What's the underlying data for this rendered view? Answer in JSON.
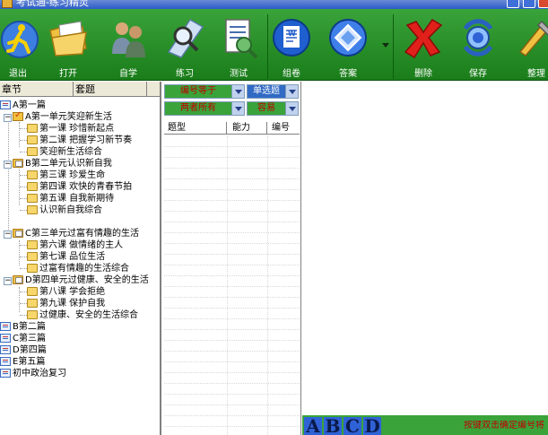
{
  "window": {
    "title": "考试通-练习精灵"
  },
  "toolbar": {
    "buttons": [
      {
        "id": "exit",
        "label": "退出",
        "icon": "running-man-icon"
      },
      {
        "id": "open",
        "label": "打开",
        "icon": "open-folder-icon"
      },
      {
        "id": "self_study",
        "label": "自学",
        "icon": "people-icon"
      },
      {
        "id": "practice",
        "label": "练习",
        "icon": "practice-magnifier-icon"
      },
      {
        "id": "test",
        "label": "测试",
        "icon": "test-document-icon"
      },
      {
        "id": "assemble",
        "label": "组卷",
        "icon": "word-document-icon"
      },
      {
        "id": "answers",
        "label": "答案",
        "icon": "answer-diamond-icon"
      },
      {
        "id": "delete",
        "label": "删除",
        "icon": "red-x-icon"
      },
      {
        "id": "save",
        "label": "保存",
        "icon": "save-globe-icon"
      },
      {
        "id": "organize",
        "label": "整理",
        "icon": "organize-tools-icon"
      }
    ]
  },
  "left_panel": {
    "tabs": [
      "章节",
      "套题"
    ],
    "tree": [
      {
        "label": "A第一篇",
        "icon": "book-icon"
      },
      {
        "label": "A第一单元笑迎新生活",
        "icon": "folder-check-icon"
      },
      {
        "label": "第一课  珍惜新起点",
        "icon": "folder-icon"
      },
      {
        "label": "第二课  把握学习新节奏",
        "icon": "folder-icon"
      },
      {
        "label": "笑迎新生活综合",
        "icon": "folder-icon"
      },
      {
        "label": "B第二单元认识新自我",
        "icon": "folder-open-icon"
      },
      {
        "label": "第三课  珍爱生命",
        "icon": "folder-icon"
      },
      {
        "label": "第四课  欢快的青春节拍",
        "icon": "folder-icon"
      },
      {
        "label": "第五课  自我新期待",
        "icon": "folder-icon"
      },
      {
        "label": "认识新自我综合",
        "icon": "folder-icon"
      },
      {
        "label": "C第三单元过富有情趣的生活",
        "icon": "folder-open-icon"
      },
      {
        "label": "第六课  做情绪的主人",
        "icon": "folder-icon"
      },
      {
        "label": "第七课  品位生活",
        "icon": "folder-icon"
      },
      {
        "label": "过富有情趣的生活综合",
        "icon": "folder-icon"
      },
      {
        "label": "D第四单元过健康、安全的生活",
        "icon": "folder-open-icon"
      },
      {
        "label": "第八课  学会拒绝",
        "icon": "folder-icon"
      },
      {
        "label": "第九课  保护自我",
        "icon": "folder-icon"
      },
      {
        "label": "过健康、安全的生活综合",
        "icon": "folder-icon"
      },
      {
        "label": "B第二篇",
        "icon": "book-icon"
      },
      {
        "label": "C第三篇",
        "icon": "book-icon"
      },
      {
        "label": "D第四篇",
        "icon": "book-icon"
      },
      {
        "label": "E第五篇",
        "icon": "book-icon"
      },
      {
        "label": "初中政治复习",
        "icon": "book-icon"
      }
    ]
  },
  "middle_panel": {
    "filters": {
      "number": "编号等于",
      "question_type": "单选题",
      "scope": "两者所有",
      "difficulty": "容易"
    },
    "columns": [
      "题型",
      "能力",
      "编号"
    ]
  },
  "right_panel": {
    "answer_buttons": [
      "A",
      "B",
      "C",
      "D"
    ],
    "hint": "按键双击确定编号将"
  }
}
